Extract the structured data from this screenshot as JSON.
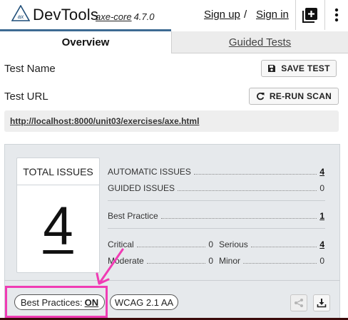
{
  "header": {
    "brand": "DevTools",
    "engine_name": "axe-core",
    "engine_version": "4.7.0",
    "sign_up": "Sign up",
    "separator": "/",
    "sign_in": "Sign in",
    "logo_text": "ax"
  },
  "tabs": [
    {
      "label": "Overview",
      "active": true
    },
    {
      "label": "Guided Tests",
      "active": false
    }
  ],
  "test_name": {
    "label": "Test Name",
    "button": "SAVE TEST"
  },
  "test_url": {
    "label": "Test URL",
    "button": "RE-RUN SCAN",
    "url": "http://localhost:8000/unit03/exercises/axe.html"
  },
  "summary": {
    "total_title": "TOTAL ISSUES",
    "total_count": "4",
    "automatic_label": "AUTOMATIC ISSUES",
    "automatic_value": "4",
    "guided_label": "GUIDED ISSUES",
    "guided_value": "0",
    "best_practice_label": "Best Practice",
    "best_practice_value": "1",
    "critical_label": "Critical",
    "critical_value": "0",
    "serious_label": "Serious",
    "serious_value": "4",
    "moderate_label": "Moderate",
    "moderate_value": "0",
    "minor_label": "Minor",
    "minor_value": "0"
  },
  "footer": {
    "best_practices_label": "Best Practices:",
    "best_practices_state": "ON",
    "wcag_label": "WCAG 2.1 AA"
  },
  "colors": {
    "accent": "#3d6b93",
    "annotation": "#f03cb4"
  },
  "icons": {
    "logo": "axe-logo-icon",
    "add": "plus-square-icon",
    "menu": "kebab-menu-icon",
    "save": "floppy-disk-icon",
    "rerun": "refresh-icon",
    "share": "share-icon",
    "export": "download-icon"
  }
}
